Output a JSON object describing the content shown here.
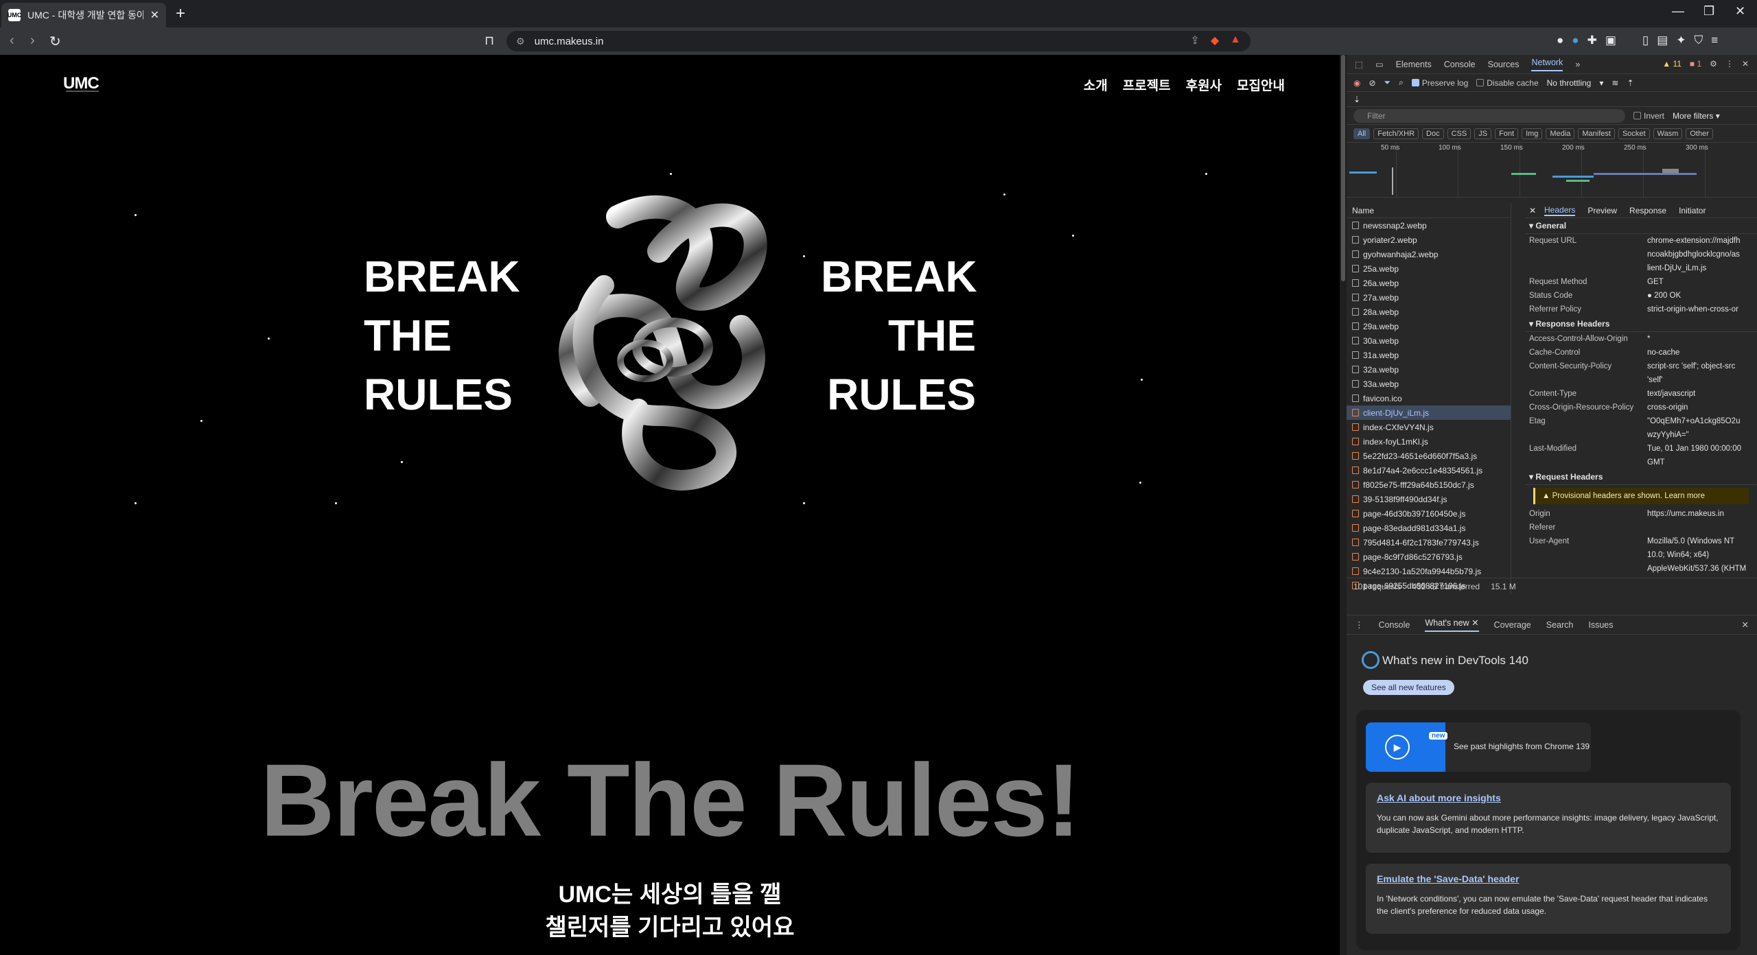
{
  "browser": {
    "tab_title": "UMC - 대학생 개발 연합 동아리",
    "favicon_text": "UMC",
    "new_tab": "+",
    "url": "umc.makeus.in",
    "window_controls": [
      "—",
      "❐",
      "✕"
    ]
  },
  "site": {
    "logo": "UMC",
    "nav": [
      "소개",
      "프로젝트",
      "후원사",
      "모집안내"
    ],
    "btr_left": [
      "BREAK",
      "THE",
      "RULES"
    ],
    "btr_right": [
      "BREAK",
      "THE",
      "RULES"
    ],
    "headline": "Break The Rules!",
    "subhead": [
      "UMC는 세상의 틀을 깰",
      "챌린저를 기다리고 있어요"
    ]
  },
  "devtools": {
    "tabs": [
      "Elements",
      "Console",
      "Sources",
      "Network"
    ],
    "active_tab": "Network",
    "warnings": "▲ 11",
    "errors": "■ 1",
    "preserve_log": "Preserve log",
    "disable_cache": "Disable cache",
    "throttling": "No throttling",
    "filter_placeholder": "Filter",
    "invert": "Invert",
    "more_filters": "More filters ▾",
    "types": [
      "All",
      "Fetch/XHR",
      "Doc",
      "CSS",
      "JS",
      "Font",
      "Img",
      "Media",
      "Manifest",
      "Socket",
      "Wasm",
      "Other"
    ],
    "timeline_labels": [
      "50 ms",
      "100 ms",
      "150 ms",
      "200 ms",
      "250 ms",
      "300 ms"
    ],
    "name_header": "Name",
    "requests": [
      {
        "name": "newssnap2.webp",
        "type": "img"
      },
      {
        "name": "yoriater2.webp",
        "type": "img"
      },
      {
        "name": "gyohwanhaja2.webp",
        "type": "img"
      },
      {
        "name": "25a.webp",
        "type": "img"
      },
      {
        "name": "26a.webp",
        "type": "img"
      },
      {
        "name": "27a.webp",
        "type": "img"
      },
      {
        "name": "28a.webp",
        "type": "img"
      },
      {
        "name": "29a.webp",
        "type": "img"
      },
      {
        "name": "30a.webp",
        "type": "img"
      },
      {
        "name": "31a.webp",
        "type": "img"
      },
      {
        "name": "32a.webp",
        "type": "img"
      },
      {
        "name": "33a.webp",
        "type": "img"
      },
      {
        "name": "favicon.ico",
        "type": "img"
      },
      {
        "name": "client-DjUv_iLm.js",
        "type": "js",
        "selected": true
      },
      {
        "name": "index-CXfeVY4N.js",
        "type": "js"
      },
      {
        "name": "index-foyL1mKl.js",
        "type": "js"
      },
      {
        "name": "5e22fd23-4651e6d660f7f5a3.js",
        "type": "js"
      },
      {
        "name": "8e1d74a4-2e6ccc1e48354561.js",
        "type": "js"
      },
      {
        "name": "f8025e75-fff29a64b5150dc7.js",
        "type": "js"
      },
      {
        "name": "39-5138f9ff490dd34f.js",
        "type": "js"
      },
      {
        "name": "page-46d30b397160450e.js",
        "type": "js"
      },
      {
        "name": "page-83edadd981d334a1.js",
        "type": "js"
      },
      {
        "name": "795d4814-6f2c1783fe779743.js",
        "type": "js"
      },
      {
        "name": "page-8c9f7d86c5276793.js",
        "type": "js"
      },
      {
        "name": "9c4e2130-1a520fa9944b5b79.js",
        "type": "js"
      },
      {
        "name": "page-69255db668827196.js",
        "type": "js"
      }
    ],
    "status_bar": [
      "101 requests",
      "432 kB transferred",
      "15.1 M"
    ],
    "detail_tabs": [
      "Headers",
      "Preview",
      "Response",
      "Initiator"
    ],
    "general_title": "▾ General",
    "general": [
      {
        "k": "Request URL",
        "v": "chrome-extension://majdfh"
      },
      {
        "k": "",
        "v": "ncoakbjgbdhglocklcgno/as"
      },
      {
        "k": "",
        "v": "lient-DjUv_iLm.js"
      },
      {
        "k": "Request Method",
        "v": "GET"
      },
      {
        "k": "Status Code",
        "v": "● 200 OK"
      },
      {
        "k": "Referrer Policy",
        "v": "strict-origin-when-cross-or"
      }
    ],
    "response_title": "▾ Response Headers",
    "response": [
      {
        "k": "Access-Control-Allow-Origin",
        "v": "*"
      },
      {
        "k": "Cache-Control",
        "v": "no-cache"
      },
      {
        "k": "Content-Security-Policy",
        "v": "script-src 'self'; object-src"
      },
      {
        "k": "",
        "v": "'self'"
      },
      {
        "k": "Content-Type",
        "v": "text/javascript"
      },
      {
        "k": "Cross-Origin-Resource-Policy",
        "v": "cross-origin"
      },
      {
        "k": "Etag",
        "v": "\"O0qEMh7+oA1ckg85O2u"
      },
      {
        "k": "",
        "v": "wzyYyhiA=\""
      },
      {
        "k": "Last-Modified",
        "v": "Tue, 01 Jan 1980 00:00:00"
      },
      {
        "k": "",
        "v": "GMT"
      }
    ],
    "request_title": "▾ Request Headers",
    "provisional": "▲ Provisional headers are shown. Learn more",
    "request": [
      {
        "k": "Origin",
        "v": "https://umc.makeus.in"
      },
      {
        "k": "Referer",
        "v": ""
      },
      {
        "k": "User-Agent",
        "v": "Mozilla/5.0 (Windows NT"
      },
      {
        "k": "",
        "v": "10.0; Win64; x64)"
      },
      {
        "k": "",
        "v": "AppleWebKit/537.36 (KHTM"
      }
    ],
    "drawer_tabs": [
      "Console",
      "What's new ✕",
      "Coverage",
      "Search",
      "Issues"
    ],
    "whatsnew_title": "What's new in DevTools 140",
    "see_all": "See all new features",
    "highlight_new": "new",
    "highlight_text": "See past highlights from Chrome 139",
    "card1_title": "Ask AI about more insights",
    "card1_text": "You can now ask Gemini about more performance insights: image delivery, legacy JavaScript, duplicate JavaScript, and modern HTTP.",
    "card2_title": "Emulate the 'Save-Data' header",
    "card2_text": "In 'Network conditions', you can now emulate the 'Save-Data' request header that indicates the client's preference for reduced data usage."
  },
  "colors": {
    "accent": "#a8c7fa",
    "headline_gray": "#7f7f7f",
    "js_orange": "#e8844a"
  }
}
